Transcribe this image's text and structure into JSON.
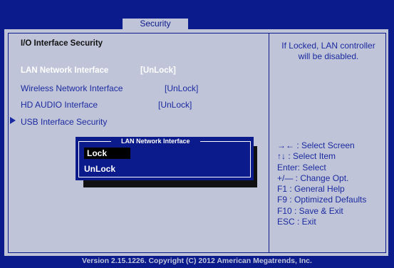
{
  "tabs": {
    "active": "Security"
  },
  "main": {
    "section_title": "I/O Interface Security",
    "items": [
      {
        "label": "LAN Network Interface",
        "value": "[UnLock]"
      },
      {
        "label": "Wireless Network Interface",
        "value": "[UnLock]"
      },
      {
        "label": "HD AUDIO Interface",
        "value": "[UnLock]"
      },
      {
        "label": "USB Interface Security"
      }
    ]
  },
  "popup": {
    "title": "LAN Network Interface",
    "options": [
      "Lock",
      "UnLock"
    ],
    "selected": "Lock"
  },
  "help": {
    "text": "If Locked, LAN controller will be disabled."
  },
  "keys": [
    "→←  : Select Screen",
    "↑↓  : Select Item",
    "Enter: Select",
    "+/—  : Change Opt.",
    "F1   : General Help",
    "F9   : Optimized Defaults",
    "F10  : Save & Exit",
    "ESC  : Exit"
  ],
  "footer": "Version 2.15.1226. Copyright (C) 2012 American Megatrends, Inc.",
  "colors": {
    "background": "#0b1b8c",
    "panel": "#c0c4d8",
    "text": "#1a2aa0",
    "selected": "#ffffff"
  }
}
